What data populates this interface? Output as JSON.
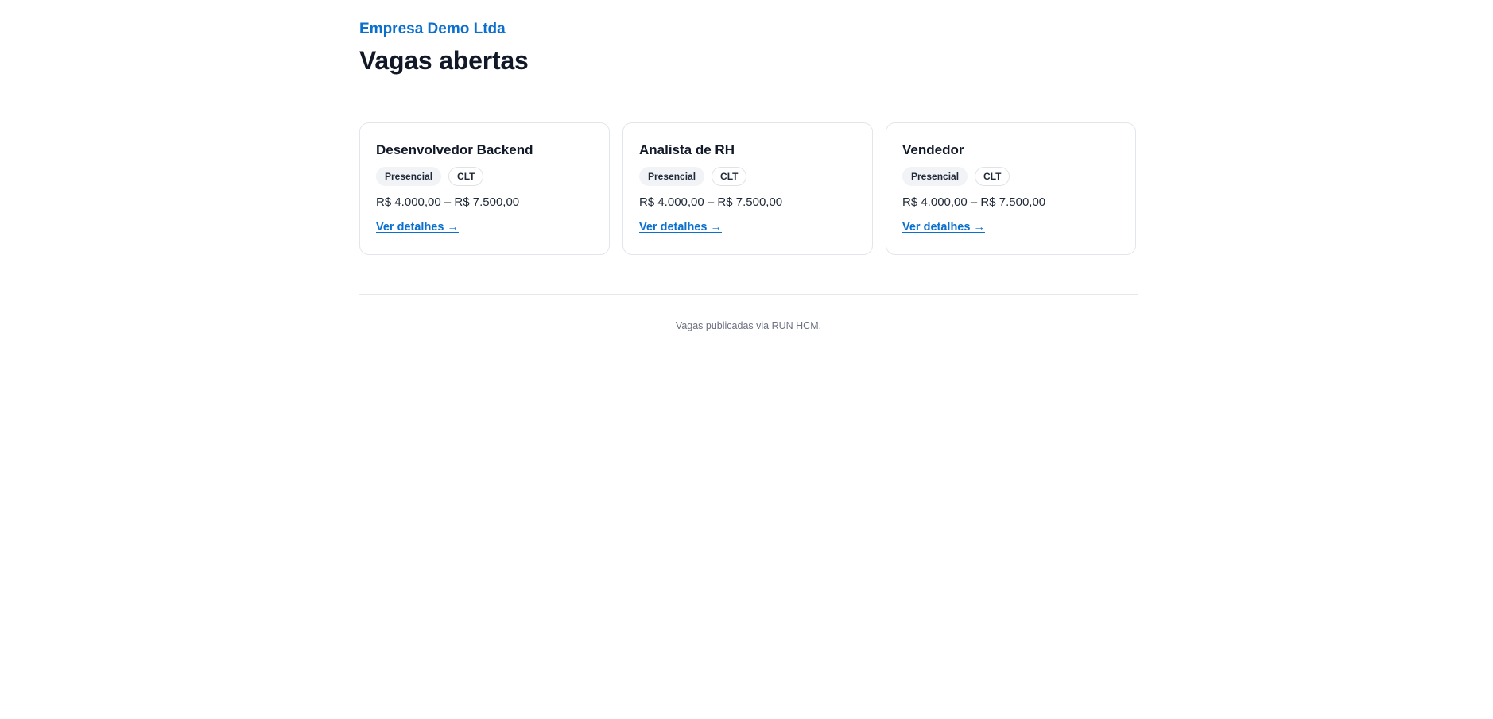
{
  "header": {
    "company": "Empresa Demo Ltda",
    "title": "Vagas abertas"
  },
  "jobs": [
    {
      "title": "Desenvolvedor Backend",
      "modality": "Presencial",
      "contract": "CLT",
      "salary": "R$ 4.000,00 – R$ 7.500,00",
      "link_label": "Ver detalhes →"
    },
    {
      "title": "Analista de RH",
      "modality": "Presencial",
      "contract": "CLT",
      "salary": "R$ 4.000,00 – R$ 7.500,00",
      "link_label": "Ver detalhes →"
    },
    {
      "title": "Vendedor",
      "modality": "Presencial",
      "contract": "CLT",
      "salary": "R$ 4.000,00 – R$ 7.500,00",
      "link_label": "Ver detalhes →"
    }
  ],
  "footer": {
    "text": "Vagas publicadas via RUN HCM."
  },
  "colors": {
    "accent": "#0b6fce",
    "rule": "#1c6fb8",
    "text": "#111827",
    "muted": "#6b7280"
  }
}
